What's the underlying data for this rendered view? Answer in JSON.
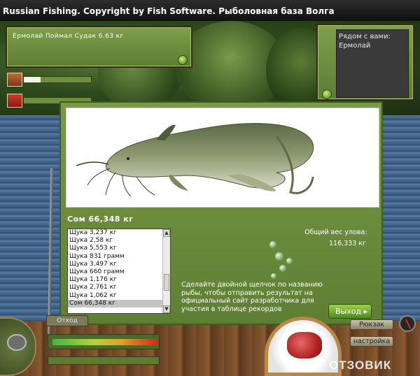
{
  "window": {
    "title": "Russian Fishing. Copyright by Fish Software. Рыболовная база Волга"
  },
  "chat": {
    "message": "Ермолай Поймал Судак 6.63 кг"
  },
  "nearby": {
    "label": "Рядом с вами:",
    "players": [
      "Ермолай"
    ]
  },
  "status": {
    "food_level": 0.25
  },
  "catch": {
    "fish_name": "Сом 66,348 кг",
    "list": [
      "Щука 3,237 кг",
      "Щука 2,58 кг",
      "Щука 5,553 кг",
      "Щука 831 грамм",
      "Щука 3,497 кг",
      "Щука 660 грамм",
      "Щука 1,176 кг",
      "Щука 2,761 кг",
      "Щука 1,062 кг",
      "Сом 66,348 кг"
    ],
    "selected_index": 9,
    "total_label": "Общий вес улова:",
    "total_value": "116,333 кг",
    "hint": "Сделайте двойной щелчок по названию рыбы, чтобы отправить результат на официальный сайт разработчика для участия в таблице рекордов",
    "exit_label": "Выход"
  },
  "bottom": {
    "tab_label": "Отход",
    "menu": [
      "Рюкзак",
      "настройка"
    ]
  },
  "watermark": "ОТЗОВИК",
  "colors": {
    "panel": "#6f8f3e",
    "accent_button": "#5fa02a",
    "fish_frame": "#ffffff"
  },
  "icons": [
    "stone-icon",
    "bait-box-icon",
    "fishing-reel-icon",
    "compass-icon",
    "bait-icon"
  ]
}
